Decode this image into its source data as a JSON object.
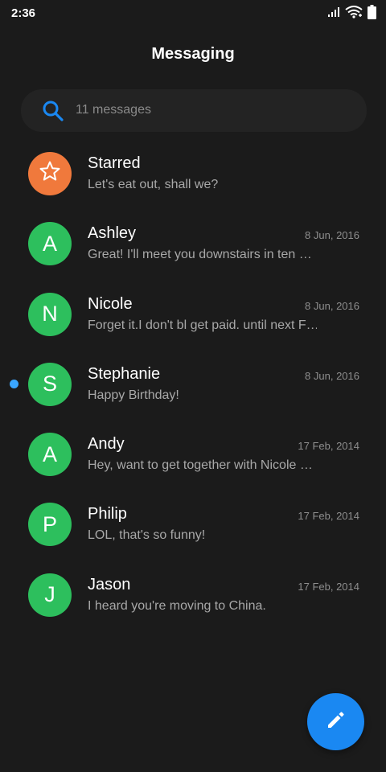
{
  "status_bar": {
    "time": "2:36",
    "icons": [
      "signal-icon",
      "wifi-icon",
      "battery-icon"
    ]
  },
  "header": {
    "title": "Messaging"
  },
  "search": {
    "icon": "search-icon",
    "placeholder": "11 messages"
  },
  "colors": {
    "accent": "#1a88f2",
    "avatar_green": "#2dbf5d",
    "avatar_orange": "#f0793c",
    "unread": "#3aa6ff",
    "background": "#1b1b1b"
  },
  "conversations": [
    {
      "name": "Starred",
      "initial": "",
      "icon": "star-icon",
      "date": "",
      "preview": "Let's eat out, shall we?",
      "unread": false
    },
    {
      "name": "Ashley",
      "initial": "A",
      "date": "8 Jun, 2016",
      "preview": "Great! I'll meet you downstairs in ten …",
      "unread": false
    },
    {
      "name": "Nicole",
      "initial": "N",
      "date": "8 Jun, 2016",
      "preview": "Forget it.I don't bl get paid. until next F…",
      "unread": false
    },
    {
      "name": "Stephanie",
      "initial": "S",
      "date": "8 Jun, 2016",
      "preview": "Happy Birthday!",
      "unread": true
    },
    {
      "name": "Andy",
      "initial": "A",
      "date": "17 Feb, 2014",
      "preview": "Hey, want to get together with Nicole …",
      "unread": false
    },
    {
      "name": "Philip",
      "initial": "P",
      "date": "17 Feb, 2014",
      "preview": "LOL, that's so funny!",
      "unread": false
    },
    {
      "name": "Jason",
      "initial": "J",
      "date": "17 Feb, 2014",
      "preview": "I heard you're moving to China.",
      "unread": false
    }
  ],
  "fab": {
    "icon": "pencil-icon"
  }
}
